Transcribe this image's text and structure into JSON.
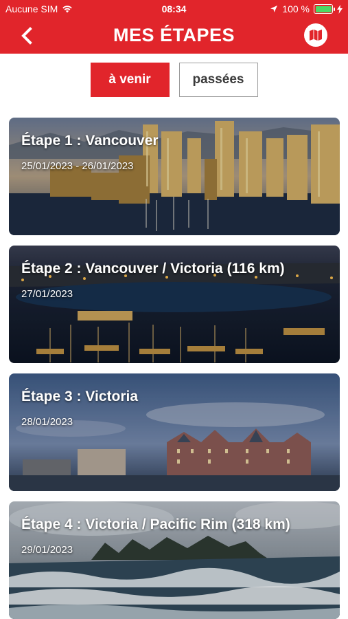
{
  "status_bar": {
    "carrier": "Aucune SIM",
    "time": "08:34",
    "battery_text": "100 %",
    "battery_level": 1.0
  },
  "nav": {
    "title": "MES ÉTAPES",
    "back_icon": "chevron-left-icon",
    "map_icon": "map-icon"
  },
  "tabs": {
    "upcoming_label": "à venir",
    "past_label": "passées",
    "active": "upcoming"
  },
  "stages": [
    {
      "title": "Étape 1 : Vancouver",
      "dates": "25/01/2023 - 26/01/2023"
    },
    {
      "title": "Étape 2 : Vancouver / Victoria  (116 km)",
      "dates": "27/01/2023"
    },
    {
      "title": "Étape 3 : Victoria",
      "dates": "28/01/2023"
    },
    {
      "title": "Étape 4 : Victoria / Pacific Rim (318 km)",
      "dates": "29/01/2023"
    }
  ],
  "colors": {
    "brand_red": "#e1252b",
    "tab_inactive_border": "#9b9b9b",
    "battery_green": "#4cd964"
  }
}
